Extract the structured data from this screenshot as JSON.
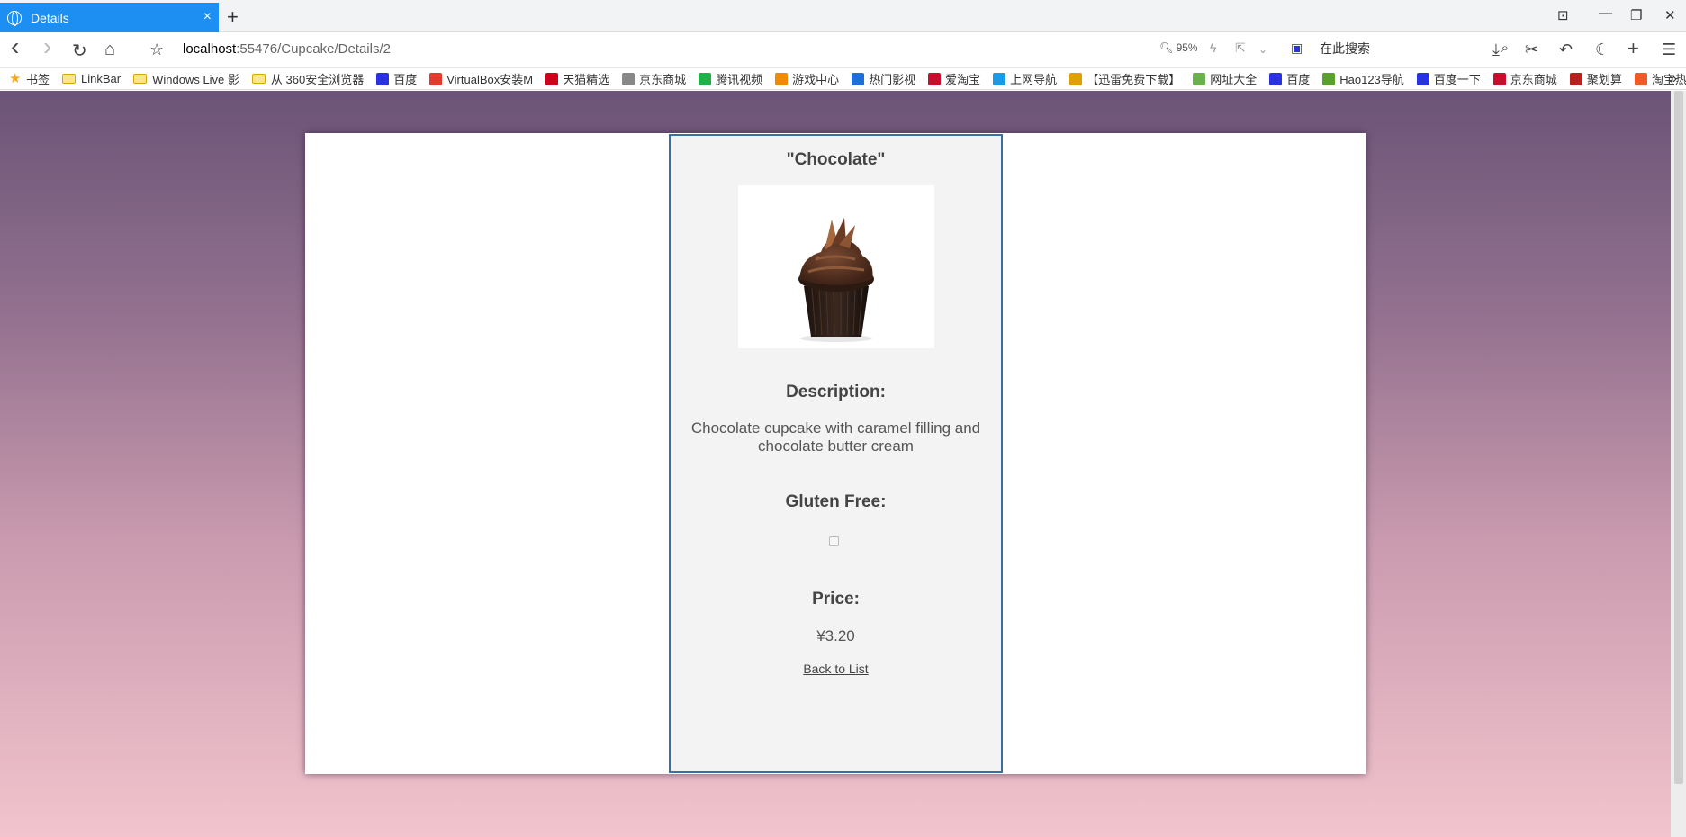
{
  "browser": {
    "tab": {
      "title": "Details",
      "close": "×"
    },
    "new_tab": "+",
    "window_controls": {
      "pin": "⊡",
      "minimize": "—",
      "restore": "❐",
      "close": "✕"
    },
    "nav": {
      "back": "‹",
      "forward": "›",
      "reload": "↻",
      "home": "⌂",
      "star": "☆"
    },
    "url": {
      "host": "localhost",
      "path": ":55476/Cupcake/Details/2"
    },
    "zoom": "95%",
    "search_placeholder": "在此搜索",
    "bookmarks": [
      {
        "label": "书签",
        "kind": "star",
        "color": "#f5a623"
      },
      {
        "label": "LinkBar",
        "kind": "folder"
      },
      {
        "label": "Windows Live 影",
        "kind": "folder"
      },
      {
        "label": "从 360安全浏览器",
        "kind": "folder"
      },
      {
        "label": "百度",
        "kind": "icon",
        "color": "#2932e1"
      },
      {
        "label": "VirtualBox安装M",
        "kind": "icon",
        "color": "#e23b2e"
      },
      {
        "label": "天猫精选",
        "kind": "icon",
        "color": "#d0021b"
      },
      {
        "label": "京东商城",
        "kind": "icon",
        "color": "#888888"
      },
      {
        "label": "腾讯视频",
        "kind": "icon",
        "color": "#20b14a"
      },
      {
        "label": "游戏中心",
        "kind": "icon",
        "color": "#f08a00"
      },
      {
        "label": "热门影视",
        "kind": "icon",
        "color": "#1e6fd9"
      },
      {
        "label": "爱淘宝",
        "kind": "icon",
        "color": "#c8102e"
      },
      {
        "label": "上网导航",
        "kind": "icon",
        "color": "#1a9be8"
      },
      {
        "label": "【迅雷免费下载】",
        "kind": "icon",
        "color": "#e0a000"
      },
      {
        "label": "网址大全",
        "kind": "icon",
        "color": "#6ab04c"
      },
      {
        "label": "百度",
        "kind": "icon",
        "color": "#2932e1"
      },
      {
        "label": "Hao123导航",
        "kind": "icon",
        "color": "#5aa02c"
      },
      {
        "label": "百度一下",
        "kind": "icon",
        "color": "#2932e1"
      },
      {
        "label": "京东商城",
        "kind": "icon",
        "color": "#c8102e"
      },
      {
        "label": "聚划算",
        "kind": "icon",
        "color": "#b8221e"
      },
      {
        "label": "淘宝热卖",
        "kind": "icon",
        "color": "#f05a28"
      }
    ],
    "bookmarks_more": "»"
  },
  "page": {
    "title": "\"Chocolate\"",
    "description_label": "Description:",
    "description": "Chocolate cupcake with caramel filling and chocolate butter cream",
    "gluten_free_label": "Gluten Free:",
    "gluten_free": false,
    "price_label": "Price:",
    "price": "¥3.20",
    "back_link": "Back to List",
    "card_border_color": "#3a6fa5"
  }
}
